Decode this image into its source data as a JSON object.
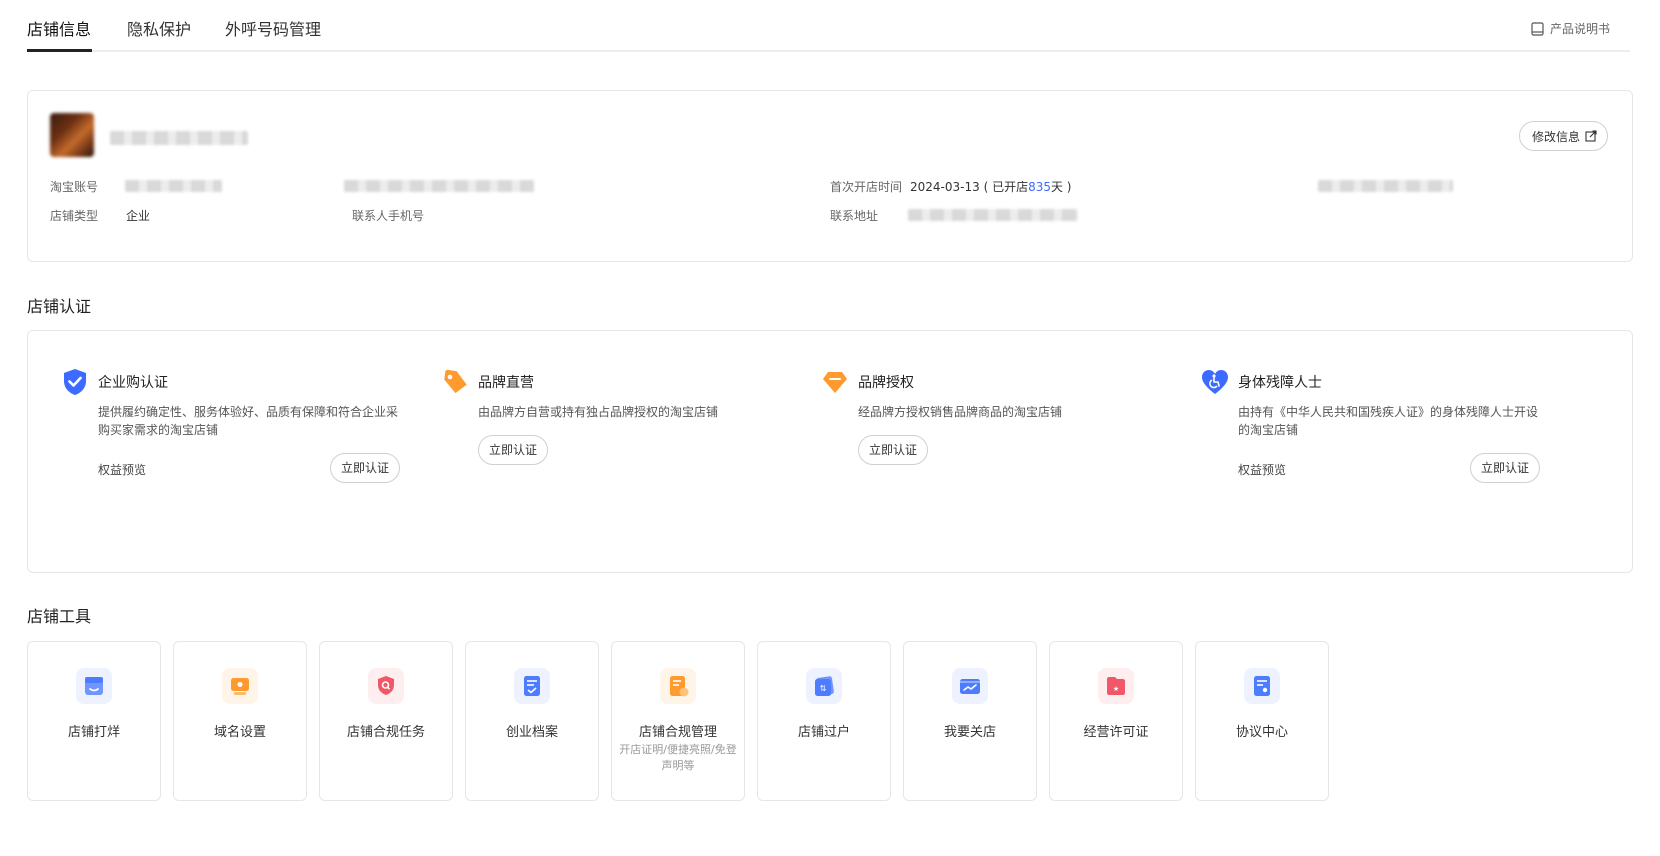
{
  "tabs": [
    {
      "label": "店铺信息",
      "active": true
    },
    {
      "label": "隐私保护",
      "active": false
    },
    {
      "label": "外呼号码管理",
      "active": false
    }
  ],
  "manual": {
    "label": "产品说明书",
    "icon": "book-icon"
  },
  "shop_info": {
    "edit_label": "修改信息",
    "taobao_account_label": "淘宝账号",
    "shop_type_label": "店铺类型",
    "shop_type_value": "企业",
    "contact_phone_label": "联系人手机号",
    "first_open_label": "首次开店时间",
    "first_open_date": "2024-03-13",
    "open_days_prefix": "( 已开店",
    "open_days": "835",
    "open_days_suffix": "天 )",
    "address_label": "联系地址"
  },
  "cert_section": {
    "title": "店铺认证",
    "items": [
      {
        "icon": "shield-check-icon",
        "title": "企业购认证",
        "desc": "提供履约确定性、服务体验好、品质有保障和符合企业采购买家需求的淘宝店铺",
        "benefit": "权益预览",
        "button": "立即认证"
      },
      {
        "icon": "tag-icon",
        "title": "品牌直营",
        "desc": "由品牌方自营或持有独占品牌授权的淘宝店铺",
        "benefit": "",
        "button": "立即认证"
      },
      {
        "icon": "diamond-icon",
        "title": "品牌授权",
        "desc": "经品牌方授权销售品牌商品的淘宝店铺",
        "benefit": "",
        "button": "立即认证"
      },
      {
        "icon": "heart-accessible-icon",
        "title": "身体残障人士",
        "desc": "由持有《中华人民共和国残疾人证》的身体残障人士开设的淘宝店铺",
        "benefit": "权益预览",
        "button": "立即认证"
      }
    ]
  },
  "tools_section": {
    "title": "店铺工具",
    "items": [
      {
        "label": "店铺打烊",
        "sub": "",
        "icon": "shop-close-icon",
        "color": "#4d7cfe"
      },
      {
        "label": "域名设置",
        "sub": "",
        "icon": "domain-icon",
        "color": "#ff9a2e"
      },
      {
        "label": "店铺合规任务",
        "sub": "",
        "icon": "compliance-shield-icon",
        "color": "#f25767"
      },
      {
        "label": "创业档案",
        "sub": "",
        "icon": "archive-icon",
        "color": "#4d7cfe"
      },
      {
        "label": "店铺合规管理",
        "sub": "开店证明/便捷亮照/免登声明等",
        "icon": "compliance-doc-icon",
        "color": "#ff9a2e"
      },
      {
        "label": "店铺过户",
        "sub": "",
        "icon": "transfer-icon",
        "color": "#4d7cfe"
      },
      {
        "label": "我要关店",
        "sub": "",
        "icon": "close-shop-icon",
        "color": "#4d7cfe"
      },
      {
        "label": "经营许可证",
        "sub": "",
        "icon": "license-icon",
        "color": "#f25767"
      },
      {
        "label": "协议中心",
        "sub": "",
        "icon": "agreement-icon",
        "color": "#4d7cfe"
      }
    ]
  },
  "colors": {
    "accent": "#3d6bff",
    "orange": "#ff9a2e",
    "red": "#f25767"
  }
}
